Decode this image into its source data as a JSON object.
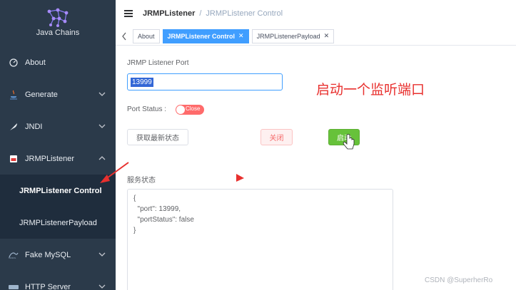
{
  "app": {
    "logo_text": "Java Chains"
  },
  "sidebar": {
    "items": [
      {
        "label": "About",
        "icon": "dashboard-icon"
      },
      {
        "label": "Generate",
        "icon": "java-icon"
      },
      {
        "label": "JNDI",
        "icon": "feather-icon"
      },
      {
        "label": "JRMPListener",
        "icon": "jrmp-icon"
      },
      {
        "label": "Fake MySQL",
        "icon": "mysql-icon"
      },
      {
        "label": "HTTP Server",
        "icon": "http-icon"
      }
    ],
    "sub_items": [
      {
        "label": "JRMPListener Control",
        "active": true
      },
      {
        "label": "JRMPListenerPayload",
        "active": false
      }
    ]
  },
  "header": {
    "breadcrumb_parent": "JRMPListener",
    "breadcrumb_sep": "/",
    "breadcrumb_current": "JRMPListener Control"
  },
  "tabs": [
    {
      "label": "About",
      "closable": false,
      "active": false
    },
    {
      "label": "JRMPListener Control",
      "closable": true,
      "active": true
    },
    {
      "label": "JRMPListenerPayload",
      "closable": true,
      "active": false
    }
  ],
  "form": {
    "port_label": "JRMP Listener Port",
    "port_value": "13999",
    "status_label": "Port Status :",
    "status_toggle_text": "Close",
    "refresh_button": "获取最新状态",
    "close_button": "关闭",
    "start_button": "启动",
    "service_label": "服务状态",
    "service_output": "{\n  \"port\": 13999,\n  \"portStatus\": false\n}"
  },
  "annotation": {
    "text": "启动一个监听端口"
  },
  "watermark": "CSDN @SuperherRo",
  "colors": {
    "sidebar_bg": "#2b3a4a",
    "submenu_bg": "#1f2d3d",
    "primary": "#409eff",
    "danger": "#f56c6c",
    "success": "#67c23a",
    "annotation_red": "#e8302e"
  }
}
